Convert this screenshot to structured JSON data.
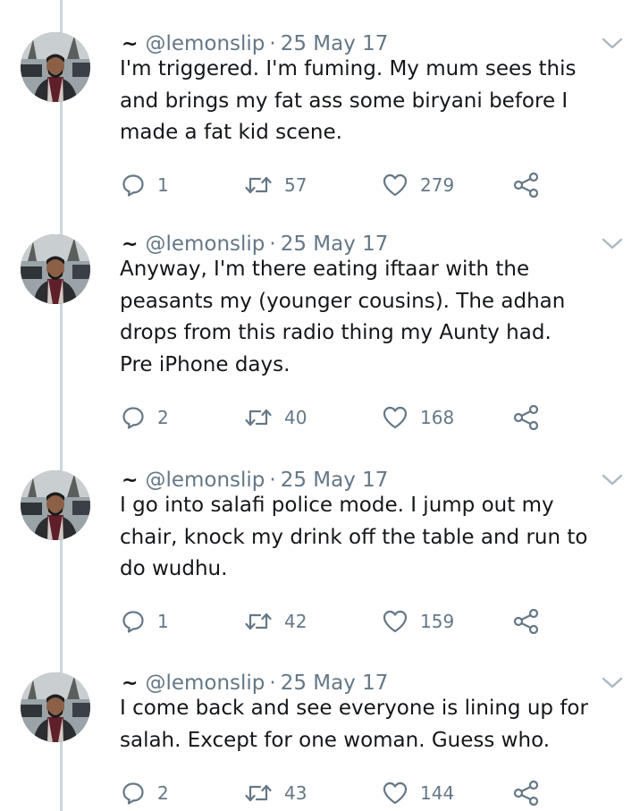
{
  "tweets": [
    {
      "handle": "@lemonslip",
      "separator": "·",
      "date": "25 May 17",
      "text": "I'm triggered. I'm fuming. My mum sees this\nand brings my fat ass some biryani before I\nmade a fat kid scene.",
      "replies": "1",
      "retweets": "57",
      "likes": "279"
    },
    {
      "handle": "@lemonslip",
      "separator": "·",
      "date": "25 May 17",
      "text": "Anyway, I'm there eating iftaar with the\npeasants my (younger cousins). The adhan\ndrops from this radio thing my Aunty had.\nPre iPhone days.",
      "replies": "2",
      "retweets": "40",
      "likes": "168"
    },
    {
      "handle": "@lemonslip",
      "separator": "·",
      "date": "25 May 17",
      "text": "I go into salafi police mode. I jump out my\nchair, knock my drink off the table and run to\ndo wudhu.",
      "replies": "1",
      "retweets": "42",
      "likes": "159"
    },
    {
      "handle": "@lemonslip",
      "separator": "·",
      "date": "25 May 17",
      "text": "I come back and see everyone is lining up for\nsalah. Except for one woman. Guess who.",
      "replies": "2",
      "retweets": "43",
      "likes": "144"
    }
  ],
  "icons": {
    "tilde": "~",
    "reply": "reply-icon",
    "retweet": "retweet-icon",
    "like": "heart-icon",
    "share": "share-icon",
    "menu": "chevron-down-icon"
  },
  "colors": {
    "text": "#14171a",
    "secondary": "#657786",
    "thread_line": "#ccd6dd"
  }
}
